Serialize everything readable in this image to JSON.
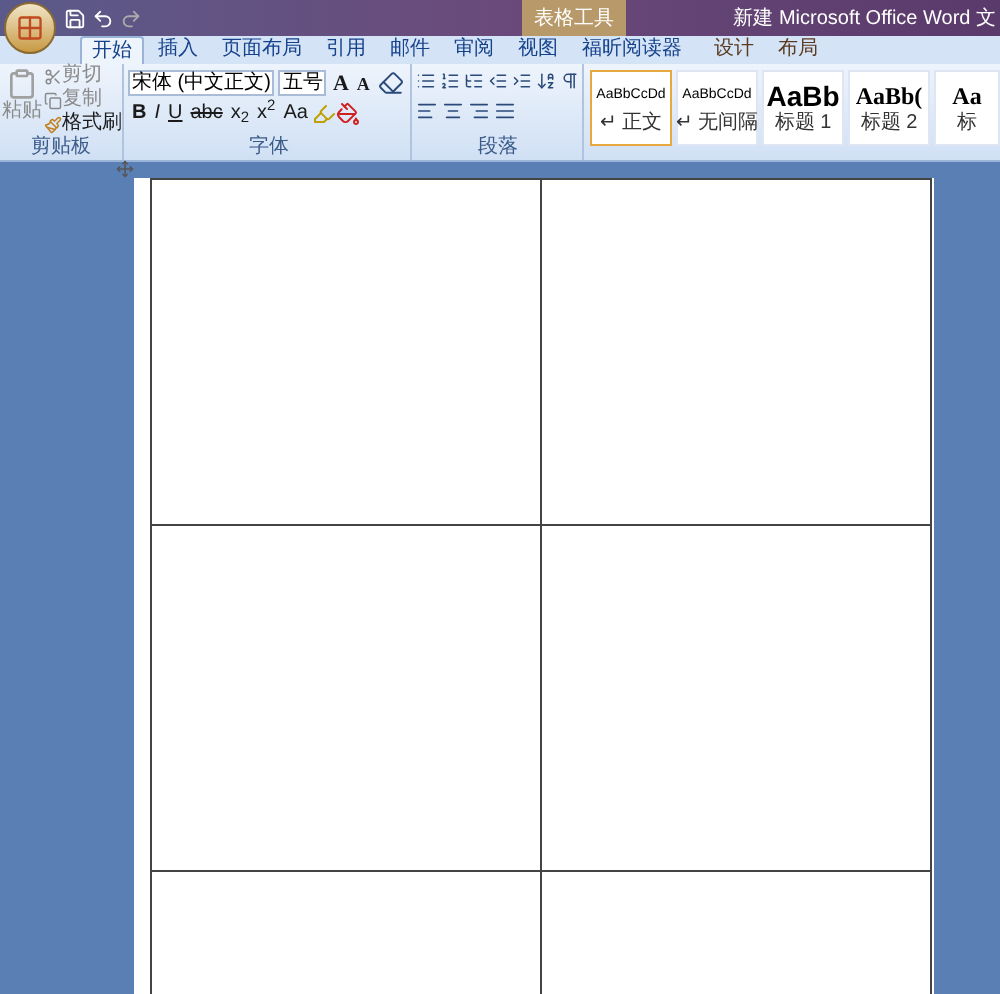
{
  "window": {
    "title": "新建 Microsoft Office Word 文",
    "contextual_group": "表格工具"
  },
  "tabs": [
    {
      "label": "开始",
      "selected": true,
      "contextual": false
    },
    {
      "label": "插入",
      "selected": false,
      "contextual": false
    },
    {
      "label": "页面布局",
      "selected": false,
      "contextual": false
    },
    {
      "label": "引用",
      "selected": false,
      "contextual": false
    },
    {
      "label": "邮件",
      "selected": false,
      "contextual": false
    },
    {
      "label": "审阅",
      "selected": false,
      "contextual": false
    },
    {
      "label": "视图",
      "selected": false,
      "contextual": false
    },
    {
      "label": "福昕阅读器",
      "selected": false,
      "contextual": false
    },
    {
      "label": "设计",
      "selected": false,
      "contextual": true
    },
    {
      "label": "布局",
      "selected": false,
      "contextual": true
    }
  ],
  "clipboard": {
    "paste": "粘贴",
    "cut": "剪切",
    "copy": "复制",
    "format_painter": "格式刷",
    "label": "剪贴板"
  },
  "font": {
    "name": "宋体 (中文正文)",
    "size": "五号",
    "row1": [
      "A",
      "A"
    ],
    "row2": [
      "B",
      "I",
      "U",
      "abc",
      "x$_{2}$",
      "x$^{2}$",
      "Aa"
    ],
    "label": "字体"
  },
  "paragraph": {
    "label": "段落"
  },
  "styles": [
    {
      "sample": "AaBbCcDd",
      "name": "↵ 正文",
      "selected": true,
      "kind": "small"
    },
    {
      "sample": "AaBbCcDd",
      "name": "↵ 无间隔",
      "selected": false,
      "kind": "small"
    },
    {
      "sample": "AaBb",
      "name": "标题 1",
      "selected": false,
      "kind": "large"
    },
    {
      "sample": "AaBb(",
      "name": "标题 2",
      "selected": false,
      "kind": "medium"
    },
    {
      "sample": "Aa",
      "name": "标",
      "selected": false,
      "kind": "medium"
    }
  ]
}
